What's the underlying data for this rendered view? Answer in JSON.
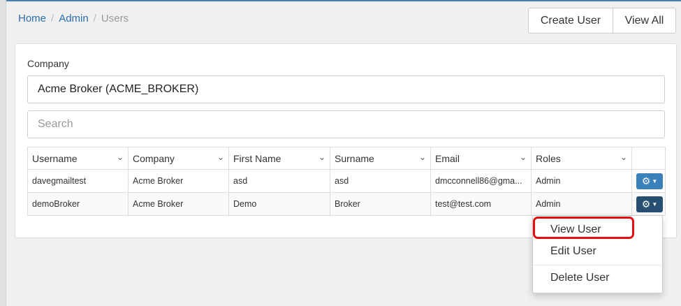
{
  "breadcrumb": {
    "home": "Home",
    "admin": "Admin",
    "current": "Users",
    "separator": "/"
  },
  "header_buttons": {
    "create_user": "Create User",
    "view_all": "View All"
  },
  "company": {
    "label": "Company",
    "selected": "Acme Broker (ACME_BROKER)"
  },
  "search": {
    "placeholder": "Search",
    "value": ""
  },
  "table": {
    "columns": [
      "Username",
      "Company",
      "First Name",
      "Surname",
      "Email",
      "Roles"
    ],
    "rows": [
      {
        "username": "davegmailtest",
        "company": "Acme Broker",
        "first_name": "asd",
        "surname": "asd",
        "email": "dmcconnell86@gma...",
        "roles": "Admin"
      },
      {
        "username": "demoBroker",
        "company": "Acme Broker",
        "first_name": "Demo",
        "surname": "Broker",
        "email": "test@test.com",
        "roles": "Admin"
      }
    ]
  },
  "action_menu": {
    "items": [
      "View User",
      "Edit User",
      "Delete User"
    ],
    "highlighted": "View User"
  },
  "icons": {
    "column_sort": "chevron-down-icon",
    "row_action": "gear-icon",
    "caret": "caret-down-icon"
  },
  "colors": {
    "link": "#2a6ead",
    "action_button": "#3a81bb",
    "action_button_active": "#264f72",
    "highlight": "#e01010"
  }
}
